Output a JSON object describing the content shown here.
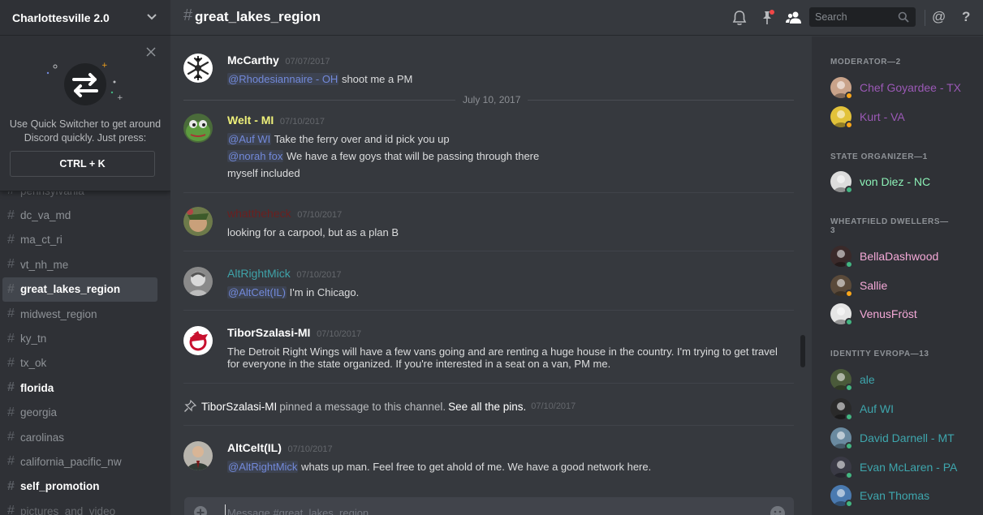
{
  "guild": {
    "name": "Charlottesville 2.0"
  },
  "quick_switcher": {
    "text": "Use Quick Switcher to get around Discord quickly. Just press:",
    "shortcut": "CTRL + K"
  },
  "channels": [
    {
      "name": "pennsylvania",
      "state": "partial"
    },
    {
      "name": "dc_va_md",
      "state": "normal"
    },
    {
      "name": "ma_ct_ri",
      "state": "normal"
    },
    {
      "name": "vt_nh_me",
      "state": "normal"
    },
    {
      "name": "great_lakes_region",
      "state": "active"
    },
    {
      "name": "midwest_region",
      "state": "normal"
    },
    {
      "name": "ky_tn",
      "state": "normal"
    },
    {
      "name": "tx_ok",
      "state": "normal"
    },
    {
      "name": "florida",
      "state": "unread"
    },
    {
      "name": "georgia",
      "state": "normal"
    },
    {
      "name": "carolinas",
      "state": "normal"
    },
    {
      "name": "california_pacific_nw",
      "state": "normal"
    },
    {
      "name": "self_promotion",
      "state": "unread"
    },
    {
      "name": "pictures_and_video",
      "state": "partial"
    }
  ],
  "topbar": {
    "hash": "#",
    "channel_title": "great_lakes_region",
    "search_placeholder": "Search",
    "at_label": "@",
    "help_label": "?"
  },
  "day_divider": "July 10, 2017",
  "messages": [
    {
      "author": "McCarthy",
      "author_color": "#ffffff",
      "timestamp": "07/07/2017",
      "lines": [
        {
          "mention": "@Rhodesiannaire - OH",
          "text": " shoot me a PM"
        }
      ]
    },
    {
      "author": "Welt - MI",
      "author_color": "#eef07a",
      "timestamp": "07/10/2017",
      "lines": [
        {
          "mention": "@Auf WI",
          "text": " Take the ferry over and id pick you up"
        },
        {
          "mention": "@norah fox",
          "text": " We have a few goys that will be passing through there"
        },
        {
          "mention": "",
          "text": "myself included"
        }
      ]
    },
    {
      "author": "whattheheck",
      "author_color": "#6b1f1f",
      "timestamp": "07/10/2017",
      "lines": [
        {
          "mention": "",
          "text": "looking for a carpool, but as a plan B"
        }
      ]
    },
    {
      "author": "AltRightMick",
      "author_color": "#3fa2a8",
      "timestamp": "07/10/2017",
      "lines": [
        {
          "mention": "@AltCelt(IL)",
          "text": " I'm in Chicago."
        }
      ]
    },
    {
      "author": "TiborSzalasi-MI",
      "author_color": "#ffffff",
      "timestamp": "07/10/2017",
      "lines": [
        {
          "mention": "",
          "text": "The Detroit Right Wings will have a few vans going and are renting a huge house in the country. I'm trying to get travel"
        },
        {
          "mention": "",
          "text": "for everyone in the state organized. If you're interested in a seat on a van, PM me."
        }
      ]
    },
    {
      "author": "AltCelt(IL)",
      "author_color": "#ffffff",
      "timestamp": "07/10/2017",
      "lines": [
        {
          "mention": "@AltRightMick",
          "text": " whats up man. Feel free to get ahold of me. We have a good network here."
        }
      ]
    }
  ],
  "pin_notice": {
    "author": "TiborSzalasi-MI",
    "text": "pinned a message to this channel.",
    "link": "See all the pins.",
    "timestamp": "07/10/2017"
  },
  "composer": {
    "placeholder": "Message #great_lakes_region"
  },
  "member_groups": [
    {
      "role": "MODERATOR—2",
      "members": [
        {
          "name": "Chef Goyardee - TX",
          "color": "#9b59b6",
          "status": "#faa61a"
        },
        {
          "name": "Kurt - VA",
          "color": "#9b59b6",
          "status": "#faa61a"
        }
      ]
    },
    {
      "role": "STATE ORGANIZER—1",
      "members": [
        {
          "name": "von Diez - NC",
          "color": "#8cf0b6",
          "status": "#43b581"
        }
      ]
    },
    {
      "role": "WHEATFIELD DWELLERS—3",
      "members": [
        {
          "name": "BellaDashwood",
          "color": "#f5a9d8",
          "status": "#43b581"
        },
        {
          "name": "Sallie",
          "color": "#f5a9d8",
          "status": "#faa61a"
        },
        {
          "name": "VenusFröst",
          "color": "#f5a9d8",
          "status": "#43b581"
        }
      ]
    },
    {
      "role": "IDENTITY EVROPA—13",
      "members": [
        {
          "name": "ale",
          "color": "#3ea6ad",
          "status": "#43b581"
        },
        {
          "name": "Auf WI",
          "color": "#3ea6ad",
          "status": "#43b581"
        },
        {
          "name": "David Darnell - MT",
          "color": "#3ea6ad",
          "status": "#43b581"
        },
        {
          "name": "Evan McLaren - PA",
          "color": "#3ea6ad",
          "status": "#43b581"
        },
        {
          "name": "Evan Thomas",
          "color": "#3ea6ad",
          "status": "#43b581"
        }
      ]
    }
  ],
  "icons": {
    "guild_chevron": "chevron-down-icon",
    "qs_close": "close-icon",
    "bell": "bell-icon",
    "pin_notifications": "pinned-messages-icon",
    "members": "member-list-icon",
    "search": "search-icon",
    "pin": "pin-icon",
    "composer_plus": "upload-plus-icon",
    "composer_emoji": "emoji-icon"
  }
}
